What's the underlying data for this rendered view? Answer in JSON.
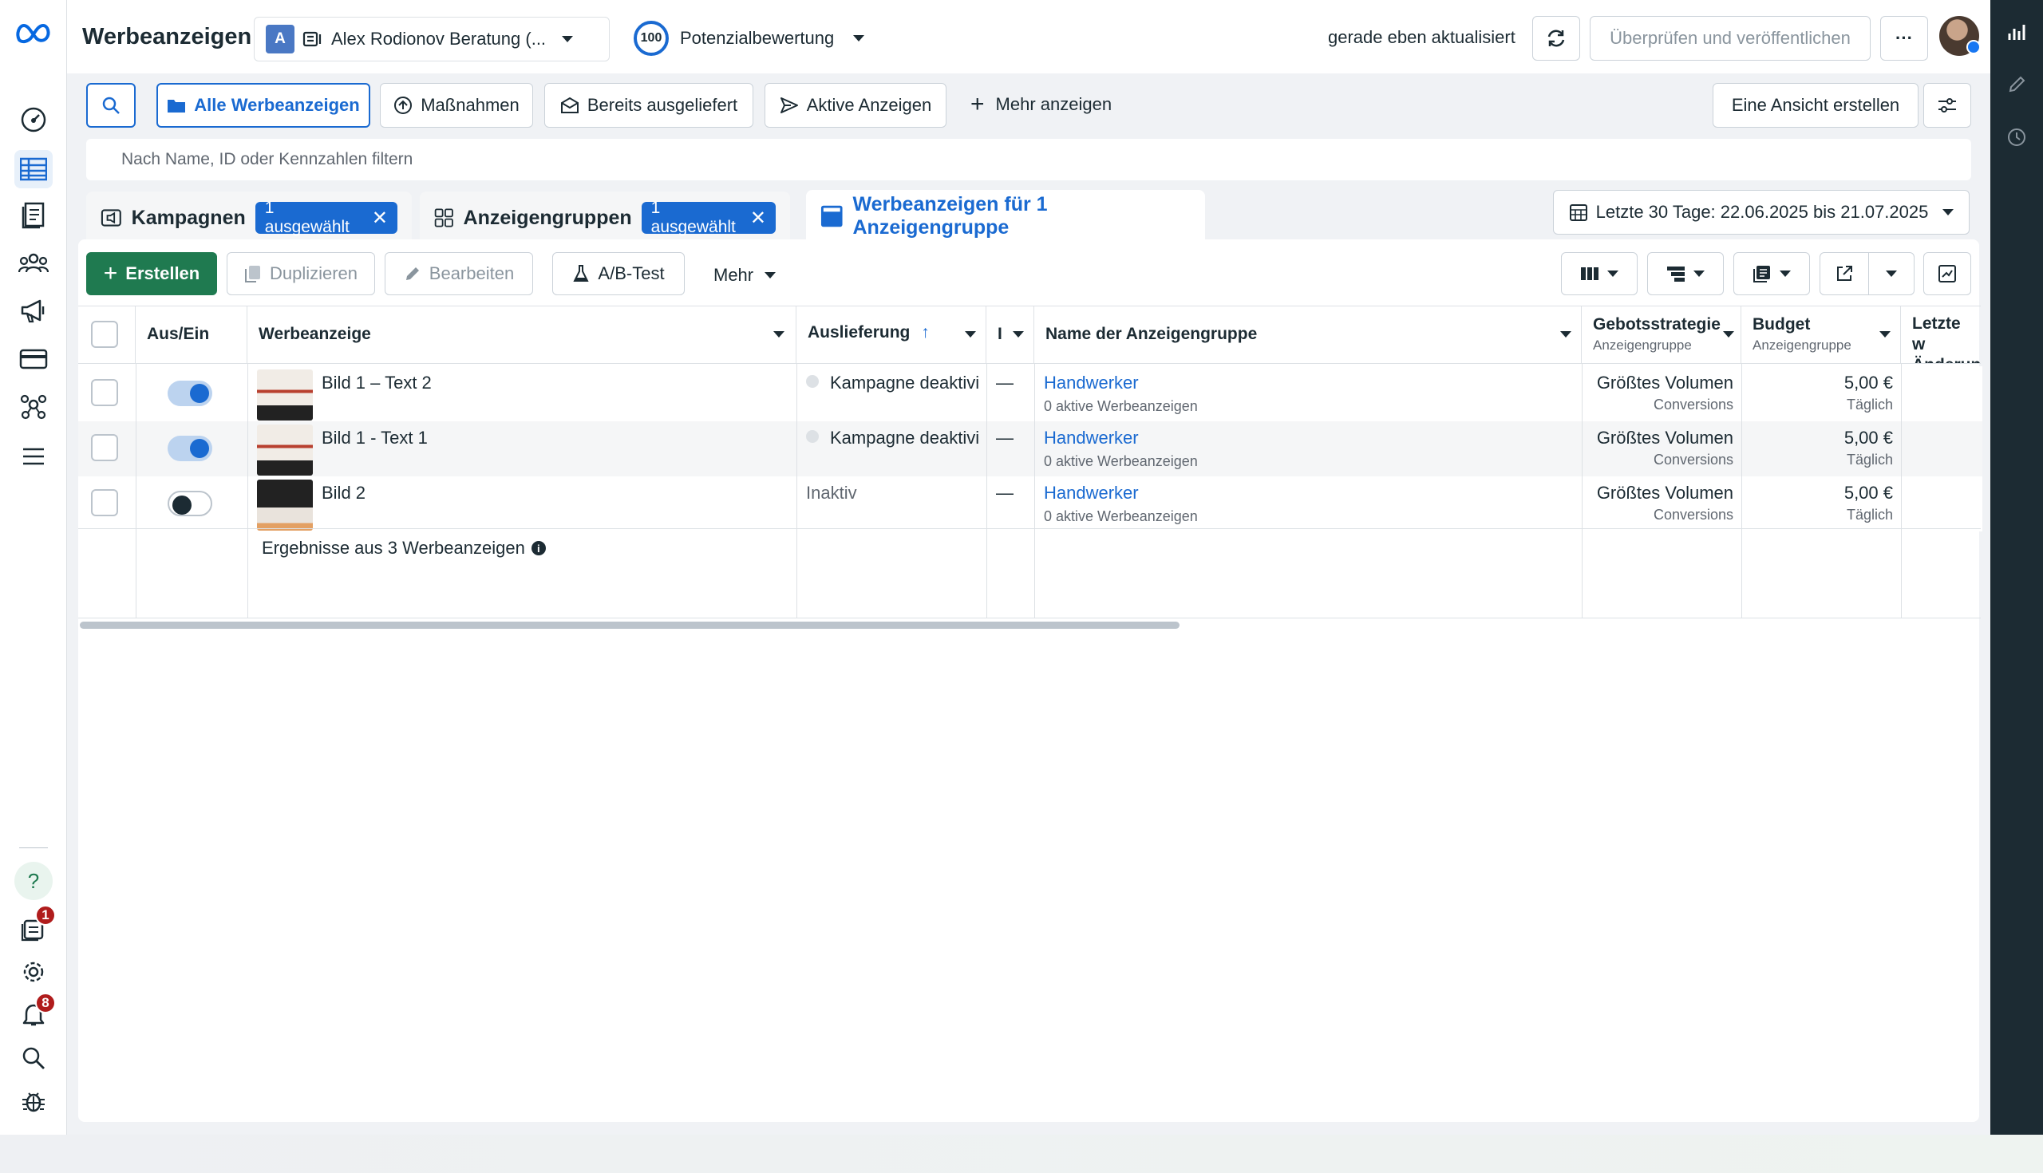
{
  "colors": {
    "accent": "#1a6ad1",
    "primary_green": "#1f7a50",
    "badge_red": "#b01c1c",
    "rail_dark": "#1c2b33"
  },
  "topbar": {
    "title": "Werbeanzeigen",
    "account_initial": "A",
    "account_name": "Alex Rodionov Beratung (...",
    "score": "100",
    "score_label": "Potenzialbewertung",
    "updated": "gerade eben aktualisiert",
    "publish": "Überprüfen und veröffentlichen",
    "more": "···"
  },
  "filterbar": {
    "all_ads": "Alle Werbeanzeigen",
    "actions": "Maßnahmen",
    "delivered": "Bereits ausgeliefert",
    "active": "Aktive Anzeigen",
    "more": "Mehr anzeigen",
    "create_view": "Eine Ansicht erstellen",
    "search_placeholder": "Nach Name, ID oder Kennzahlen filtern"
  },
  "tabs": {
    "campaigns": "Kampagnen",
    "campaigns_chip": "1 ausgewählt",
    "adsets": "Anzeigengruppen",
    "adsets_chip": "1 ausgewählt",
    "ads": "Werbeanzeigen für 1 Anzeigengruppe",
    "date_range": "Letzte 30 Tage: 22.06.2025 bis 21.07.2025"
  },
  "toolbar": {
    "create": "Erstellen",
    "duplicate": "Duplizieren",
    "edit": "Bearbeiten",
    "abtest": "A/B-Test",
    "more": "Mehr"
  },
  "columns": {
    "onoff": "Aus/Ein",
    "ad": "Werbeanzeige",
    "delivery": "Auslieferung",
    "narrow": "I",
    "adset_name": "Name der Anzeigengruppe",
    "bid": "Gebotsstrategie",
    "bid_sub": "Anzeigengruppe",
    "budget": "Budget",
    "budget_sub": "Anzeigengruppe",
    "last_change": "Letzte w",
    "last_change_2": "Änderun"
  },
  "rows": [
    {
      "name": "Bild 1 – Text 2",
      "on": true,
      "delivery": "Kampagne deaktivi",
      "dash": "—",
      "adset": "Handwerker",
      "adset_sub": "0 aktive Werbeanzeigen",
      "bid": "Größtes Volumen",
      "bid_sub": "Conversions",
      "budget": "5,00 €",
      "budget_sub": "Täglich"
    },
    {
      "name": "Bild 1 - Text 1",
      "on": true,
      "delivery": "Kampagne deaktivi",
      "dash": "—",
      "adset": "Handwerker",
      "adset_sub": "0 aktive Werbeanzeigen",
      "bid": "Größtes Volumen",
      "bid_sub": "Conversions",
      "budget": "5,00 €",
      "budget_sub": "Täglich"
    },
    {
      "name": "Bild 2",
      "on": false,
      "delivery": "Inaktiv",
      "dash": "—",
      "adset": "Handwerker",
      "adset_sub": "0 aktive Werbeanzeigen",
      "bid": "Größtes Volumen",
      "bid_sub": "Conversions",
      "budget": "5,00 €",
      "budget_sub": "Täglich"
    }
  ],
  "summary": "Ergebnisse aus 3 Werbeanzeigen",
  "leftnav": {
    "help": "?",
    "badge_inbox": "1",
    "badge_notifications": "8",
    "icons": [
      "dashboard-icon",
      "table-icon",
      "pages-icon",
      "audience-icon",
      "megaphone-icon",
      "billing-icon",
      "business-icon",
      "menu-icon",
      "help-icon",
      "inbox-icon",
      "settings-icon",
      "notifications-icon",
      "search-icon",
      "bug-icon"
    ]
  }
}
